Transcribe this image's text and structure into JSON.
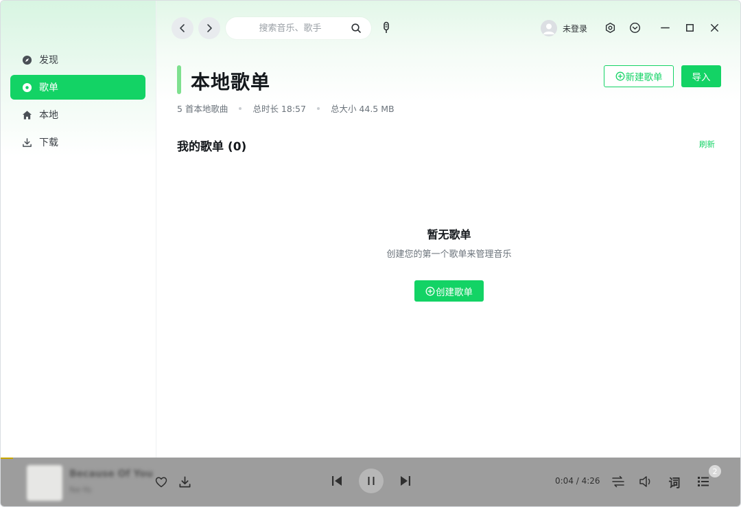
{
  "sidebar": {
    "items": [
      {
        "label": "发现",
        "icon": "compass-icon",
        "active": false
      },
      {
        "label": "歌单",
        "icon": "disc-icon",
        "active": true
      },
      {
        "label": "本地",
        "icon": "home-icon",
        "active": false
      },
      {
        "label": "下载",
        "icon": "download-icon",
        "active": false
      }
    ]
  },
  "topbar": {
    "search_placeholder": "搜索音乐、歌手",
    "user_name": "未登录"
  },
  "page": {
    "title": "本地歌单",
    "meta": {
      "song_count": "5 首本地歌曲",
      "duration": "总时长 18:57",
      "size": "总大小 44.5 MB"
    },
    "new_playlist_label": "新建歌单",
    "import_label": "导入"
  },
  "section": {
    "title": "我的歌单 (0)",
    "refresh_label": "刷新"
  },
  "empty": {
    "title": "暂无歌单",
    "subtitle": "创建您的第一个歌单来管理音乐",
    "create_label": "创建歌单"
  },
  "player": {
    "song_title": "Because Of You",
    "song_artist": "Ne-Yo",
    "time": "0:04 / 4:26",
    "lyrics_label": "词",
    "queue_count": "2"
  },
  "colors": {
    "accent": "#13d365",
    "title_bar": "#7ee08f",
    "player_bg": "#9d9d9d"
  }
}
